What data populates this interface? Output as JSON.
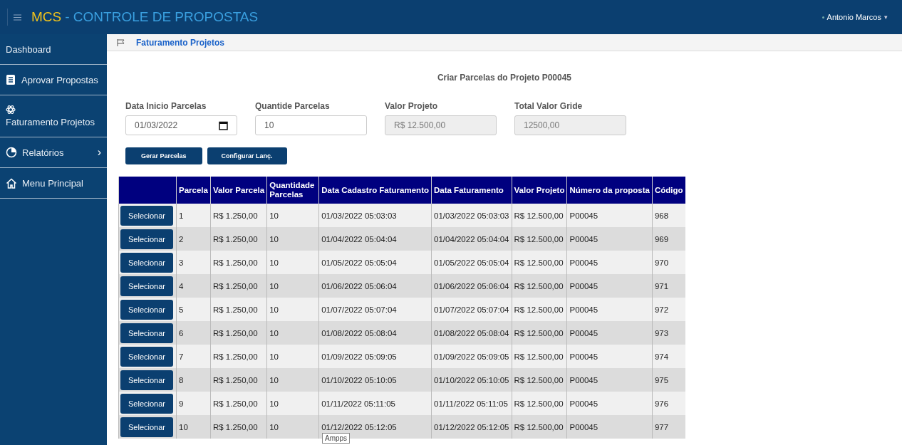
{
  "header": {
    "brand": "MCS",
    "title": "- CONTROLE DE PROPOSTAS",
    "user": "Antonio Marcos",
    "user_caret": "▾"
  },
  "sidebar": {
    "items": [
      {
        "label": "Dashboard",
        "kind": "plain"
      },
      {
        "label": "Aprovar Propostas",
        "kind": "document"
      },
      {
        "label": "Faturamento Projetos",
        "kind": "atom"
      },
      {
        "label": "Relatórios",
        "kind": "pie",
        "chevron": "›"
      },
      {
        "label": "Menu Principal",
        "kind": "home"
      }
    ]
  },
  "breadcrumb": "Faturamento Projetos",
  "page_title": "Criar Parcelas do Projeto P00045",
  "fields": [
    {
      "label": "Data Inicio Parcelas",
      "value": "01/03/2022",
      "kind": "date",
      "disabled": false
    },
    {
      "label": "Quantide Parcelas",
      "value": "10",
      "kind": "text",
      "disabled": false
    },
    {
      "label": "Valor Projeto",
      "value": "R$ 12.500,00",
      "kind": "text",
      "disabled": true
    },
    {
      "label": "Total Valor Gride",
      "value": "12500,00",
      "kind": "text",
      "disabled": true
    }
  ],
  "buttons": [
    "Gerar Parcelas",
    "Configurar Lanç."
  ],
  "table": {
    "columns": [
      "Parcela",
      "Valor Parcela",
      "Quantidade Parcelas",
      "Data Cadastro Faturamento",
      "Data Faturamento",
      "Valor Projeto",
      "Número da proposta",
      "Código"
    ],
    "rows": [
      {
        "button": "Selecionar",
        "cells": [
          "1",
          "R$ 1.250,00",
          "10",
          "01/03/2022 05:03:03",
          "01/03/2022 05:03:03",
          "R$ 12.500,00",
          "P00045",
          "968"
        ]
      },
      {
        "button": "Selecionar",
        "cells": [
          "2",
          "R$ 1.250,00",
          "10",
          "01/04/2022 05:04:04",
          "01/04/2022 05:04:04",
          "R$ 12.500,00",
          "P00045",
          "969"
        ]
      },
      {
        "button": "Selecionar",
        "cells": [
          "3",
          "R$ 1.250,00",
          "10",
          "01/05/2022 05:05:04",
          "01/05/2022 05:05:04",
          "R$ 12.500,00",
          "P00045",
          "970"
        ]
      },
      {
        "button": "Selecionar",
        "cells": [
          "4",
          "R$ 1.250,00",
          "10",
          "01/06/2022 05:06:04",
          "01/06/2022 05:06:04",
          "R$ 12.500,00",
          "P00045",
          "971"
        ]
      },
      {
        "button": "Selecionar",
        "cells": [
          "5",
          "R$ 1.250,00",
          "10",
          "01/07/2022 05:07:04",
          "01/07/2022 05:07:04",
          "R$ 12.500,00",
          "P00045",
          "972"
        ]
      },
      {
        "button": "Selecionar",
        "cells": [
          "6",
          "R$ 1.250,00",
          "10",
          "01/08/2022 05:08:04",
          "01/08/2022 05:08:04",
          "R$ 12.500,00",
          "P00045",
          "973"
        ]
      },
      {
        "button": "Selecionar",
        "cells": [
          "7",
          "R$ 1.250,00",
          "10",
          "01/09/2022 05:09:05",
          "01/09/2022 05:09:05",
          "R$ 12.500,00",
          "P00045",
          "974"
        ]
      },
      {
        "button": "Selecionar",
        "cells": [
          "8",
          "R$ 1.250,00",
          "10",
          "01/10/2022 05:10:05",
          "01/10/2022 05:10:05",
          "R$ 12.500,00",
          "P00045",
          "975"
        ]
      },
      {
        "button": "Selecionar",
        "cells": [
          "9",
          "R$ 1.250,00",
          "10",
          "01/11/2022 05:11:05",
          "01/11/2022 05:11:05",
          "R$ 12.500,00",
          "P00045",
          "976"
        ]
      },
      {
        "button": "Selecionar",
        "cells": [
          "10",
          "R$ 1.250,00",
          "10",
          "01/12/2022 05:12:05",
          "01/12/2022 05:12:05",
          "R$ 12.500,00",
          "P00045",
          "977"
        ]
      }
    ]
  },
  "tooltip": "Ampps"
}
